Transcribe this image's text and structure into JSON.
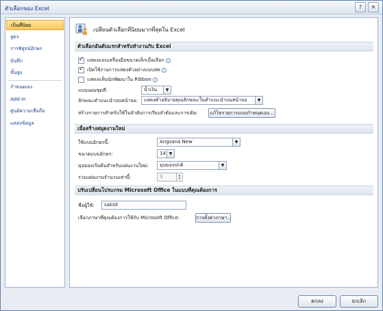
{
  "window": {
    "title": "ตัวเลือกของ Excel",
    "help_glyph": "?",
    "close_glyph": "✕"
  },
  "sidebar": {
    "items": [
      {
        "label": "เป็นที่นิยม"
      },
      {
        "label": "สูตร"
      },
      {
        "label": "การพิสูจน์อักษร"
      },
      {
        "label": "บันทึก"
      },
      {
        "label": "ขั้นสูง"
      },
      {
        "label": "กำหนดเอง"
      },
      {
        "label": "Add-in"
      },
      {
        "label": "ศูนย์ความเชื่อถือ"
      },
      {
        "label": "แหล่งข้อมูล"
      }
    ]
  },
  "main": {
    "header_text": "เปลี่ยนตัวเลือกที่นิยมมากที่สุดใน Excel",
    "section1": {
      "title": "ตัวเลือกอันดับแรกสำหรับทำงานกับ Excel",
      "show_minitoolbar": "แสดงแถบเครื่องมือขนาดเล็กเมื่อเลือก",
      "live_preview": "เปิดใช้งานการแสดงตัวอย่างแบบสด",
      "developer_tab": "แสดงแท็บนักพัฒนาใน Ribbon",
      "color_scheme_label": "แบบแผนชุดสี:",
      "color_scheme_value": "น้ำเงิน",
      "screentip_label": "ลักษณะคำแนะนำบนหน้าจอ:",
      "screentip_value": "แสดงคำอธิบายคุณลักษณะในคำแนะนำบนหน้าจอ",
      "custom_lists_label": "สร้างรายการสำหรับใช้ในลำดับการเรียงลำดับและการเติม:",
      "custom_lists_button": "แก้ไขรายการแบบกำหนดเอง..."
    },
    "section2": {
      "title": "เมื่อสร้างสมุดงานใหม่",
      "font_label": "ใช้แบบอักษรนี้:",
      "font_value": "Angsana New",
      "size_label": "ขนาดแบบอักษร:",
      "size_value": "14",
      "view_label": "มุมมองเริ่มต้นสำหรับแผ่นงานใหม่:",
      "view_value": "มุมมองปกติ",
      "sheets_label": "รวมแผ่นงานจำนวนเท่านี้:",
      "sheets_value": "3"
    },
    "section3": {
      "title": "ปรับเปลี่ยนโปรแกรม Microsoft Office ในแบบที่คุณต้องการ",
      "username_label": "ชื่อผู้ใช้:",
      "username_value": "saksit",
      "language_label": "เลือกภาษาที่คุณต้องการใช้กับ Microsoft Office:",
      "language_button": "การตั้งค่าภาษา..."
    }
  },
  "footer": {
    "ok_label": "ตกลง",
    "cancel_label": "ยกเลิก"
  }
}
